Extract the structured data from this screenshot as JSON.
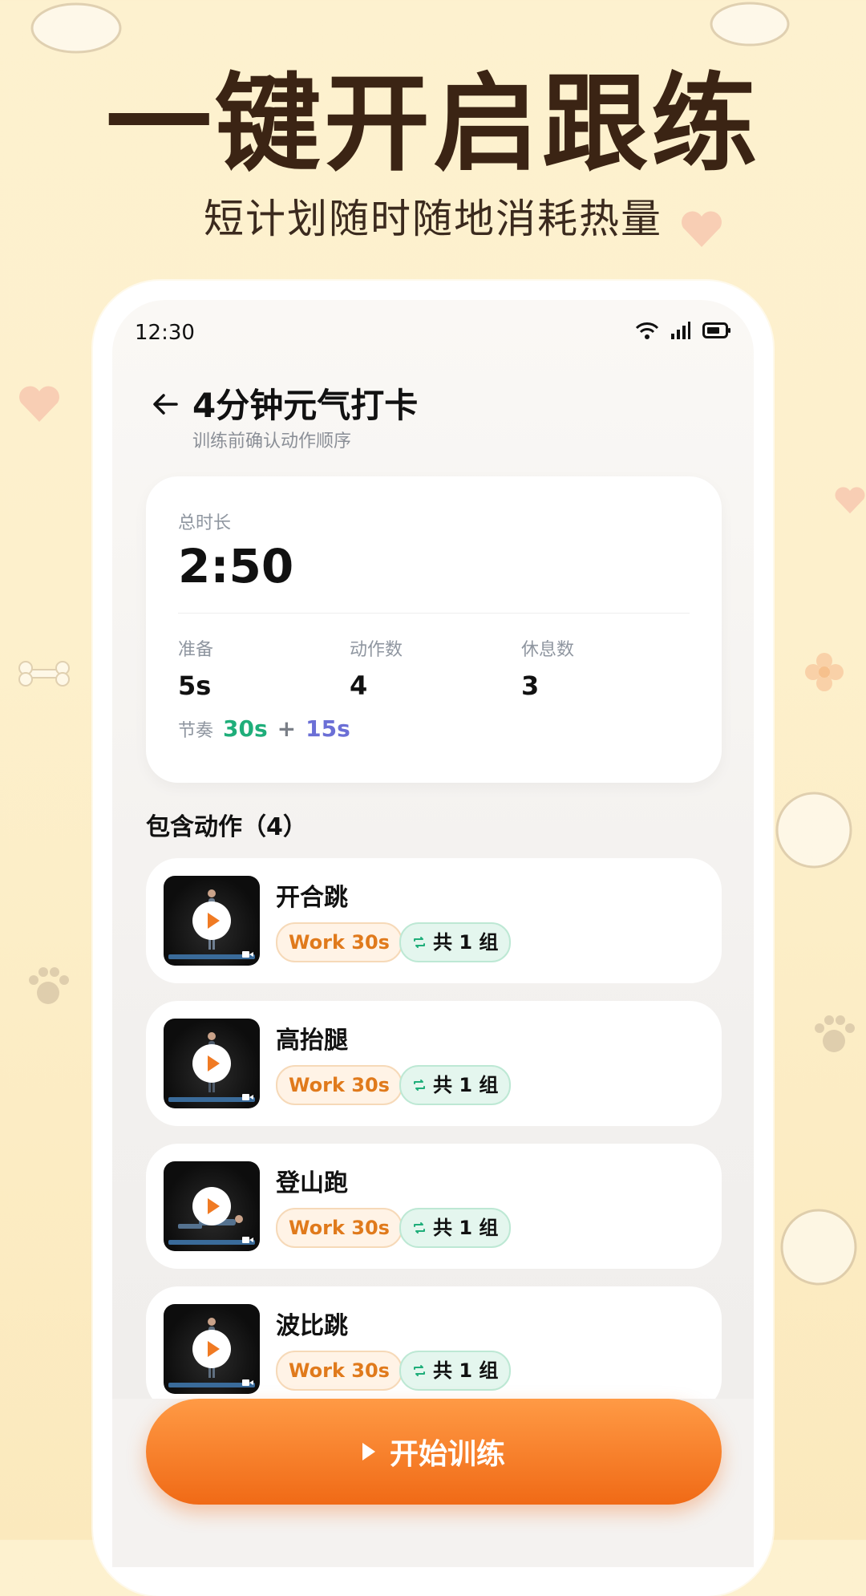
{
  "promo": {
    "headline": "一键开启跟练",
    "subline": "短计划随时随地消耗热量"
  },
  "status_bar": {
    "time": "12:30",
    "icons": [
      "wifi-icon",
      "signal-icon",
      "battery-icon"
    ]
  },
  "header": {
    "title": "4分钟元气打卡",
    "subtitle": "训练前确认动作顺序"
  },
  "summary": {
    "total_label": "总时长",
    "total_value": "2:50",
    "stats": [
      {
        "label": "准备",
        "value": "5s"
      },
      {
        "label": "动作数",
        "value": "4"
      },
      {
        "label": "休息数",
        "value": "3"
      }
    ],
    "rhythm_label": "节奏",
    "rhythm_work": "30s",
    "rhythm_plus": "+",
    "rhythm_rest": "15s"
  },
  "section": {
    "title": "包含动作（4）"
  },
  "exercises": [
    {
      "name": "开合跳",
      "work": "Work 30s",
      "sets": "共 1 组"
    },
    {
      "name": "高抬腿",
      "work": "Work 30s",
      "sets": "共 1 组"
    },
    {
      "name": "登山跑",
      "work": "Work 30s",
      "sets": "共 1 组"
    },
    {
      "name": "波比跳",
      "work": "Work 30s",
      "sets": "共 1 组"
    }
  ],
  "cta": {
    "label": "开始训练"
  },
  "colors": {
    "accent_orange": "#f06a16",
    "work_green": "#1fae7a",
    "rest_purple": "#6b6fd6",
    "headline_brown": "#3b2414"
  }
}
